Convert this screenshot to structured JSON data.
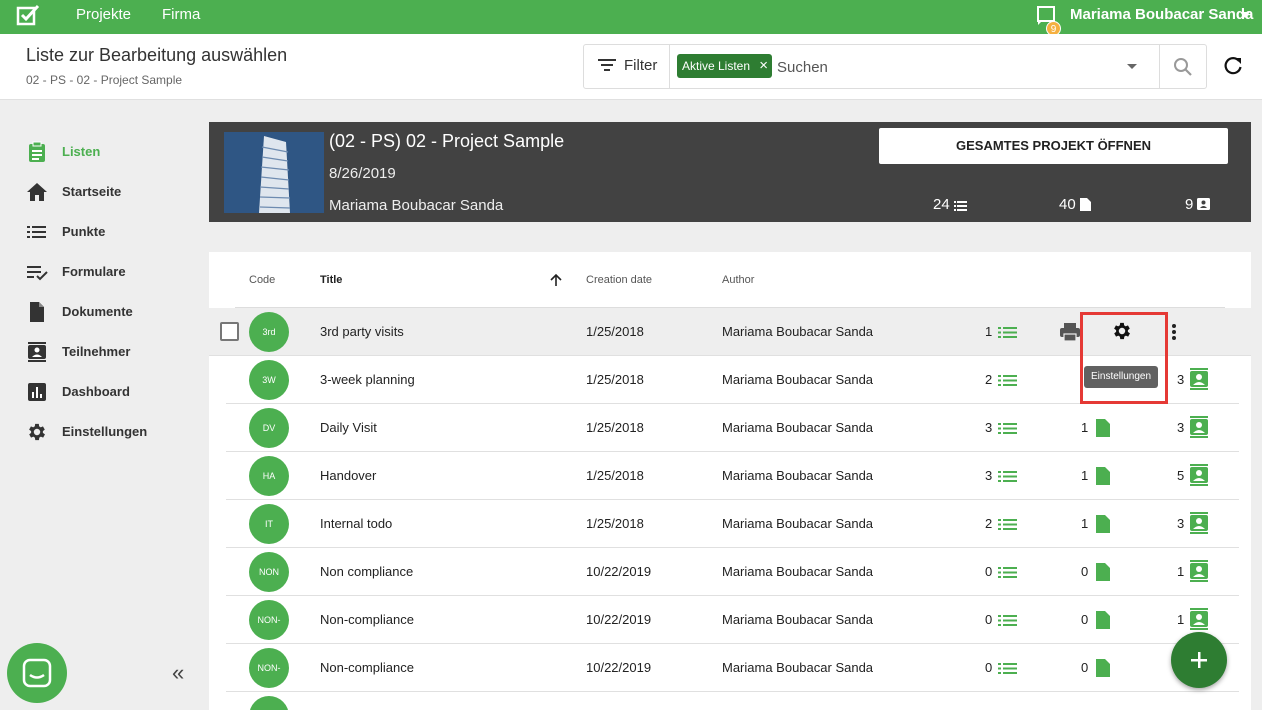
{
  "topbar": {
    "nav": [
      "Projekte",
      "Firma"
    ],
    "notification_count": "9",
    "user_name": "Mariama Boubacar Sanda"
  },
  "header": {
    "title": "Liste zur Bearbeitung auswählen",
    "breadcrumb": "02 - PS - 02 - Project Sample",
    "filter_label": "Filter",
    "chip_label": "Aktive Listen",
    "search_placeholder": "Suchen"
  },
  "sidebar": {
    "items": [
      {
        "label": "Listen",
        "icon": "clipboard-list-icon",
        "active": true
      },
      {
        "label": "Startseite",
        "icon": "home-icon"
      },
      {
        "label": "Punkte",
        "icon": "list-icon"
      },
      {
        "label": "Formulare",
        "icon": "checklist-icon"
      },
      {
        "label": "Dokumente",
        "icon": "document-icon"
      },
      {
        "label": "Teilnehmer",
        "icon": "contact-card-icon"
      },
      {
        "label": "Dashboard",
        "icon": "bar-chart-icon"
      },
      {
        "label": "Einstellungen",
        "icon": "gear-icon"
      }
    ],
    "collapse": "«"
  },
  "project": {
    "title": "(02 - PS) 02 - Project Sample",
    "date": "8/26/2019",
    "author": "Mariama Boubacar Sanda",
    "open_button": "GESAMTES PROJEKT ÖFFNEN",
    "stats": {
      "items": "24",
      "documents": "40",
      "participants": "9"
    }
  },
  "table": {
    "columns": {
      "code": "Code",
      "title": "Title",
      "creation_date": "Creation date",
      "author": "Author"
    },
    "tooltip": "Einstellungen",
    "rows": [
      {
        "code": "3rd",
        "title": "3rd party visits",
        "date": "1/25/2018",
        "author": "Mariama Boubacar Sanda",
        "items": "1",
        "docs": "",
        "participants": ""
      },
      {
        "code": "3W",
        "title": "3-week planning",
        "date": "1/25/2018",
        "author": "Mariama Boubacar Sanda",
        "items": "2",
        "docs": "",
        "participants": "3"
      },
      {
        "code": "DV",
        "title": "Daily Visit",
        "date": "1/25/2018",
        "author": "Mariama Boubacar Sanda",
        "items": "3",
        "docs": "1",
        "participants": "3"
      },
      {
        "code": "HA",
        "title": "Handover",
        "date": "1/25/2018",
        "author": "Mariama Boubacar Sanda",
        "items": "3",
        "docs": "1",
        "participants": "5"
      },
      {
        "code": "IT",
        "title": "Internal todo",
        "date": "1/25/2018",
        "author": "Mariama Boubacar Sanda",
        "items": "2",
        "docs": "1",
        "participants": "3"
      },
      {
        "code": "NON",
        "title": "Non compliance",
        "date": "10/22/2019",
        "author": "Mariama Boubacar Sanda",
        "items": "0",
        "docs": "0",
        "participants": "1"
      },
      {
        "code": "NON-",
        "title": "Non-compliance",
        "date": "10/22/2019",
        "author": "Mariama Boubacar Sanda",
        "items": "0",
        "docs": "0",
        "participants": "1"
      },
      {
        "code": "NON-",
        "title": "Non-compliance",
        "date": "10/22/2019",
        "author": "Mariama Boubacar Sanda",
        "items": "0",
        "docs": "0",
        "participants": ""
      }
    ]
  },
  "colors": {
    "brand": "#4caf50",
    "brand_dark": "#2e7d32",
    "highlight": "#e53935"
  }
}
